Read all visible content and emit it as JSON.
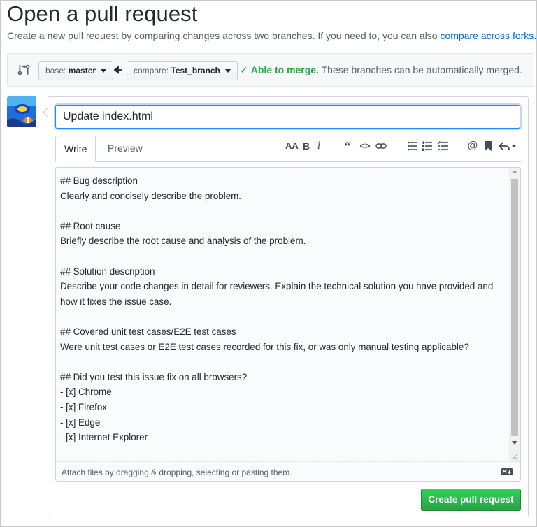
{
  "page": {
    "title": "Open a pull request",
    "subtitle_text": "Create a new pull request by comparing changes across two branches. If you need to, you can also",
    "subtitle_link": "compare across forks."
  },
  "compare": {
    "base_label": "base:",
    "base_value": "master",
    "compare_label": "compare:",
    "compare_value": "Test_branch",
    "merge_ok": "Able to merge.",
    "merge_msg": "These branches can be automatically merged.",
    "status_color": "#28a745"
  },
  "form": {
    "title_value": "Update index.html",
    "tabs": [
      {
        "label": "Write",
        "active": true
      },
      {
        "label": "Preview",
        "active": false
      }
    ],
    "toolbar_icons": [
      "text-size-icon",
      "bold-icon",
      "italic-icon",
      "quote-icon",
      "code-icon",
      "link-icon",
      "bullet-list-icon",
      "numbered-list-icon",
      "task-list-icon",
      "mention-icon",
      "saved-reply-icon",
      "reply-icon"
    ],
    "body_lines": [
      "## Bug description",
      "Clearly and concisely describe the problem.",
      "",
      "## Root cause",
      "Briefly describe the root cause and analysis of the problem.",
      "",
      "## Solution description",
      "Describe your code changes in detail for reviewers. Explain the technical solution you have provided and",
      "how it fixes the issue case.",
      "",
      "## Covered unit test cases/E2E test cases",
      "Were unit test cases or E2E test cases recorded for this fix, or was only manual testing applicable?",
      "",
      "## Did you test this issue fix on all browsers?",
      "- [x] Chrome",
      "- [x] Firefox",
      "- [x] Edge",
      "- [x] Internet Explorer"
    ],
    "attach_text": "Attach files by dragging & dropping, selecting or pasting them.",
    "submit_label": "Create pull request",
    "accent_color": "#2ea44f"
  }
}
